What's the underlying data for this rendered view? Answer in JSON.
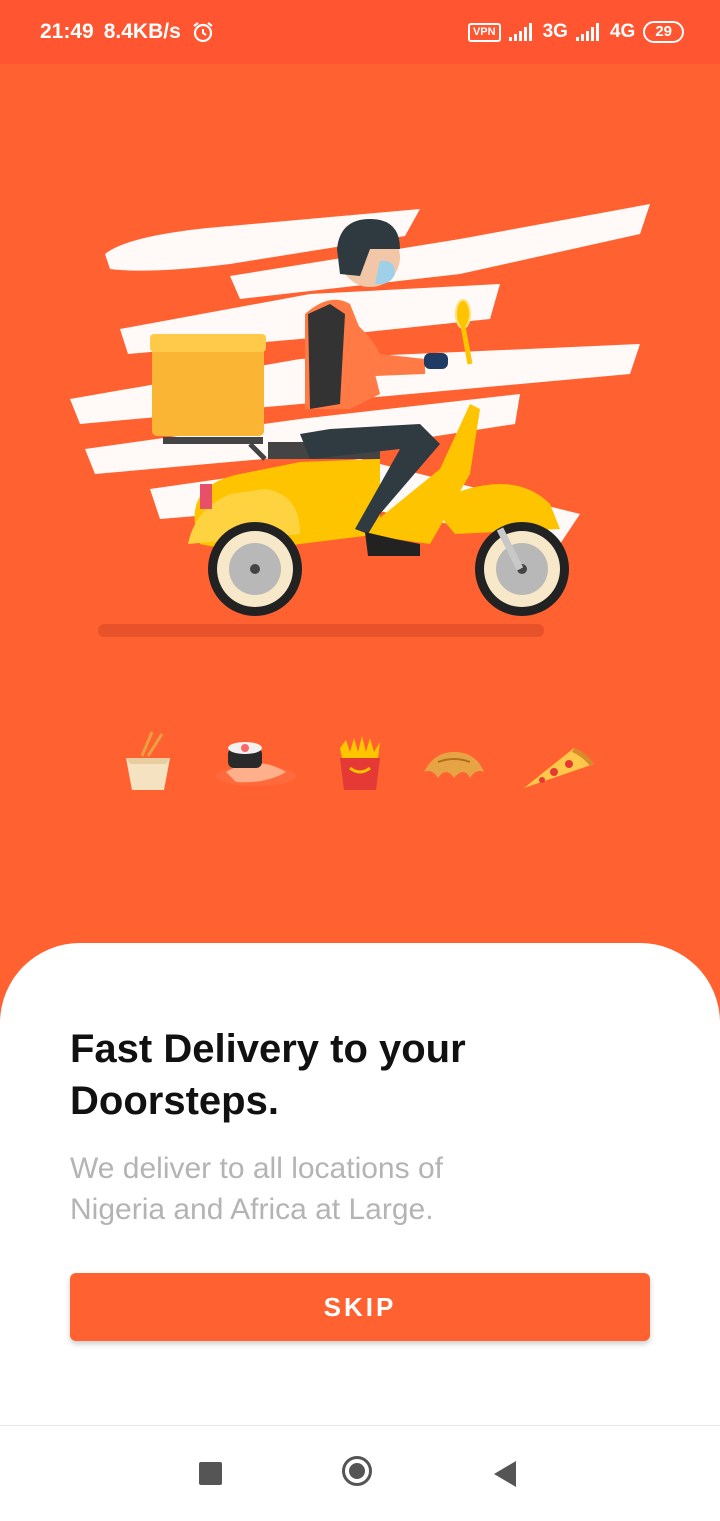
{
  "status_bar": {
    "time": "21:49",
    "network_speed": "8.4KB/s",
    "vpn": "VPN",
    "network_3g": "3G",
    "network_4g": "4G",
    "battery": "29"
  },
  "colors": {
    "brand": "#FF6230",
    "status_bar": "#FF5530",
    "scooter": "#FFC400",
    "delivery_box": "#FBB534"
  },
  "hero": {
    "illustration": "delivery-rider-scooter",
    "food_icons": [
      "noodle-box-icon",
      "sushi-icon",
      "fries-icon",
      "croissant-icon",
      "pizza-slice-icon"
    ]
  },
  "onboarding": {
    "title_line1": "Fast Delivery to your",
    "title_line2": "Doorsteps.",
    "subtitle_line1": "We deliver to all locations of",
    "subtitle_line2": "Nigeria and Africa at Large.",
    "skip_label": "SKIP"
  },
  "nav_bar": {
    "items": [
      "recent-apps-icon",
      "home-icon",
      "back-icon"
    ]
  }
}
